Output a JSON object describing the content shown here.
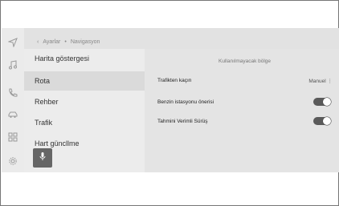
{
  "breadcrumb": {
    "back_icon": "chevron-left-icon",
    "parent": "Ayarlar",
    "separator": "•",
    "current": "Navigasyon"
  },
  "left_rail": {
    "icons": [
      "navigation-arrow-icon",
      "music-note-icon",
      "phone-icon",
      "car-icon",
      "apps-grid-icon",
      "gear-icon"
    ]
  },
  "menu": {
    "items": [
      {
        "label": "Harita göstergesi",
        "active": false
      },
      {
        "label": "Rota",
        "active": true
      },
      {
        "label": "Rehber",
        "active": false
      },
      {
        "label": "Trafik",
        "active": false
      },
      {
        "label": "Hart güncllme",
        "active": false
      }
    ]
  },
  "content": {
    "unused_area_label": "Kullanılmayacak bölge",
    "rows": [
      {
        "label": "Trafikten kaçın",
        "value": "Manuel",
        "control": "dropdown"
      },
      {
        "label": "Benzin istasyonu önerisi",
        "control": "toggle",
        "on": true
      },
      {
        "label": "Tahmini Verimli Sürüş",
        "control": "toggle",
        "on": true
      }
    ]
  },
  "mic_button": {
    "icon": "microphone-icon"
  },
  "colors": {
    "screen_bg": "#e2e2e2",
    "active_item_bg": "#dadada",
    "toggle_on": "#5a5a5a",
    "mic_bg": "#666666"
  }
}
